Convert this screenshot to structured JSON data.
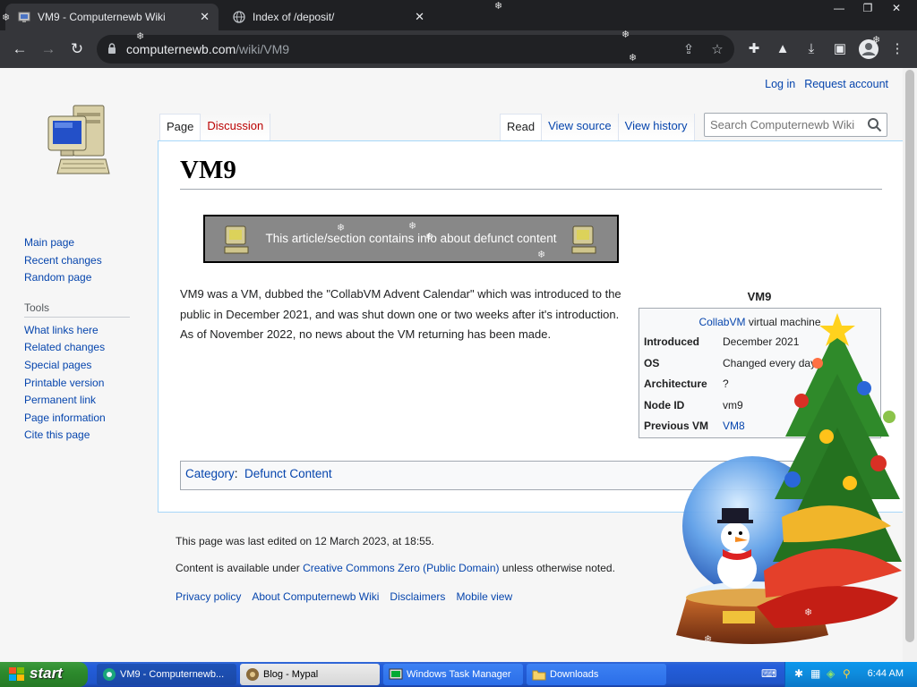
{
  "browser": {
    "tabs": [
      {
        "title": "VM9 - Computernewb Wiki",
        "active": true
      },
      {
        "title": "Index of /deposit/",
        "active": false
      }
    ],
    "url_host": "computernewb.com",
    "url_path": "/wiki/VM9"
  },
  "wiki": {
    "personal": {
      "login": "Log in",
      "request": "Request account"
    },
    "tabs_left": [
      "Page",
      "Discussion"
    ],
    "tabs_right": [
      "Read",
      "View source",
      "View history"
    ],
    "search_placeholder": "Search Computernewb Wiki",
    "sidebar_nav": [
      "Main page",
      "Recent changes",
      "Random page"
    ],
    "tools_heading": "Tools",
    "tools": [
      "What links here",
      "Related changes",
      "Special pages",
      "Printable version",
      "Permanent link",
      "Page information",
      "Cite this page"
    ],
    "title": "VM9",
    "notice": "This article/section contains info about defunct content",
    "body": "VM9 was a VM, dubbed the \"CollabVM Advent Calendar\" which was introduced to the public in December 2021, and was shut down one or two weeks after it's introduction. As of November 2022, no news about the VM returning has been made.",
    "infobox": {
      "title": "VM9",
      "caption_link": "CollabVM",
      "caption_rest": " virtual machine",
      "rows": [
        {
          "k": "Introduced",
          "v": "December 2021"
        },
        {
          "k": "OS",
          "v": "Changed every day"
        },
        {
          "k": "Architecture",
          "v": "?"
        },
        {
          "k": "Node ID",
          "v": "vm9"
        },
        {
          "k": "Previous VM",
          "v": "VM8"
        }
      ]
    },
    "category_label": "Category",
    "category": "Defunct Content",
    "footer": {
      "edited": "This page was last edited on 12 March 2023, at 18:55.",
      "license_pre": "Content is available under ",
      "license_link": "Creative Commons Zero (Public Domain)",
      "license_post": " unless otherwise noted.",
      "places": [
        "Privacy policy",
        "About Computernewb Wiki",
        "Disclaimers",
        "Mobile view"
      ]
    }
  },
  "taskbar": {
    "start": "start",
    "buttons": [
      "VM9 - Computernewb...",
      "Blog - Mypal",
      "Windows Task Manager",
      "Downloads"
    ],
    "clock": "6:44 AM"
  },
  "colors": {
    "link": "#0645ad",
    "new_link": "#ba0000",
    "chrome_dark": "#35363a",
    "xp_blue": "#245edb",
    "xp_start": "#2d8a2d"
  }
}
